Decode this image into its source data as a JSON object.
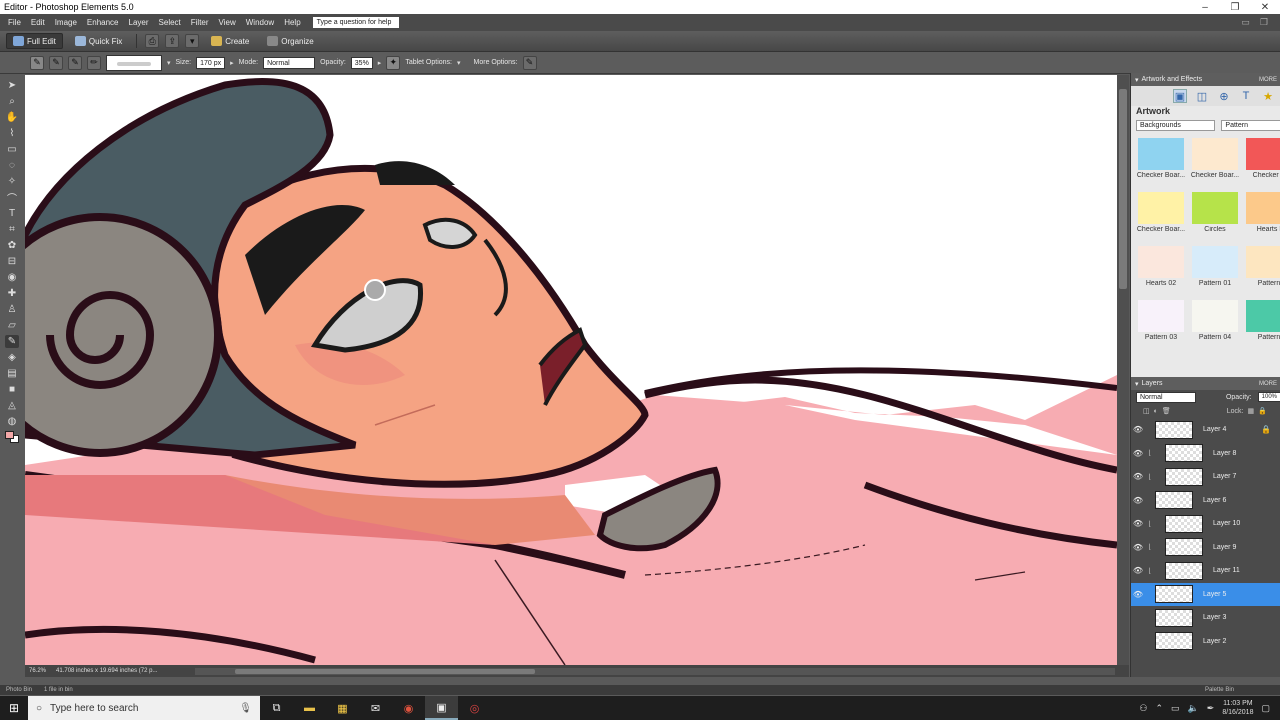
{
  "window": {
    "title": "Editor - Photoshop Elements 5.0",
    "controls": [
      "–",
      "❐",
      "✕"
    ]
  },
  "menubar": {
    "items": [
      "File",
      "Edit",
      "Image",
      "Enhance",
      "Layer",
      "Select",
      "Filter",
      "View",
      "Window",
      "Help"
    ],
    "help_field": "Type a question for help"
  },
  "modebar": {
    "full_edit": "Full Edit",
    "quick_fix": "Quick Fix",
    "create": "Create",
    "organize": "Organize"
  },
  "options": {
    "size_label": "Size:",
    "size_value": "170 px",
    "mode_label": "Mode:",
    "mode_value": "Normal",
    "opacity_label": "Opacity:",
    "opacity_value": "35%",
    "tablet_label": "Tablet Options:",
    "more_label": "More Options:"
  },
  "status": {
    "zoom": "76.2%",
    "doc_size": "41.708 inches x 19.694 inches (72 p..."
  },
  "artwork_panel": {
    "header": "Artwork and Effects",
    "more": "MORE",
    "title": "Artwork",
    "category": "Backgrounds",
    "filter": "Pattern",
    "thumbs": [
      {
        "label": "Checker Boar...",
        "color": "#8fd3f0"
      },
      {
        "label": "Checker Boar...",
        "color": "#fde9cf"
      },
      {
        "label": "Checker B",
        "color": "#f25757"
      },
      {
        "label": "Checker Boar...",
        "color": "#fff2a6"
      },
      {
        "label": "Circles",
        "color": "#b6e34a"
      },
      {
        "label": "Hearts I",
        "color": "#fcc98a"
      },
      {
        "label": "Hearts 02",
        "color": "#fbe7dd"
      },
      {
        "label": "Pattern 01",
        "color": "#d7ecfa"
      },
      {
        "label": "Pattern",
        "color": "#fde6c0"
      },
      {
        "label": "Pattern 03",
        "color": "#f8f2fa"
      },
      {
        "label": "Pattern 04",
        "color": "#f6f6f0"
      },
      {
        "label": "Pattern",
        "color": "#4cc9a7"
      }
    ]
  },
  "layers_panel": {
    "header": "Layers",
    "more": "MORE",
    "blend_mode": "Normal",
    "opacity_label": "Opacity:",
    "opacity_value": "100%",
    "lock_label": "Lock:",
    "layers": [
      {
        "name": "Layer 4",
        "clipped": false,
        "selected": false,
        "visible": true,
        "locked": true
      },
      {
        "name": "Layer 8",
        "clipped": true,
        "selected": false,
        "visible": true,
        "locked": false
      },
      {
        "name": "Layer 7",
        "clipped": true,
        "selected": false,
        "visible": true,
        "locked": false
      },
      {
        "name": "Layer 6",
        "clipped": false,
        "selected": false,
        "visible": true,
        "locked": false
      },
      {
        "name": "Layer 10",
        "clipped": true,
        "selected": false,
        "visible": true,
        "locked": false
      },
      {
        "name": "Layer 9",
        "clipped": true,
        "selected": false,
        "visible": true,
        "locked": false
      },
      {
        "name": "Layer 11",
        "clipped": true,
        "selected": false,
        "visible": true,
        "locked": false
      },
      {
        "name": "Layer 5",
        "clipped": false,
        "selected": true,
        "visible": true,
        "locked": false
      },
      {
        "name": "Layer 3",
        "clipped": false,
        "selected": false,
        "visible": false,
        "locked": false
      },
      {
        "name": "Layer 2",
        "clipped": false,
        "selected": false,
        "visible": false,
        "locked": false
      }
    ]
  },
  "bin": {
    "photo_bin": "Photo Bin",
    "files_info": "1 file in bin",
    "palette_bin": "Palette Bin"
  },
  "taskbar": {
    "search_placeholder": "Type here to search",
    "time": "11:03 PM",
    "date": "8/16/2018"
  },
  "colors": {
    "accent": "#3a8ee8",
    "skin": "#f5a383",
    "hair": "#4a5c63",
    "horn": "#8b8680",
    "shirt": "#f7acb2",
    "outline": "#2a0d18"
  }
}
